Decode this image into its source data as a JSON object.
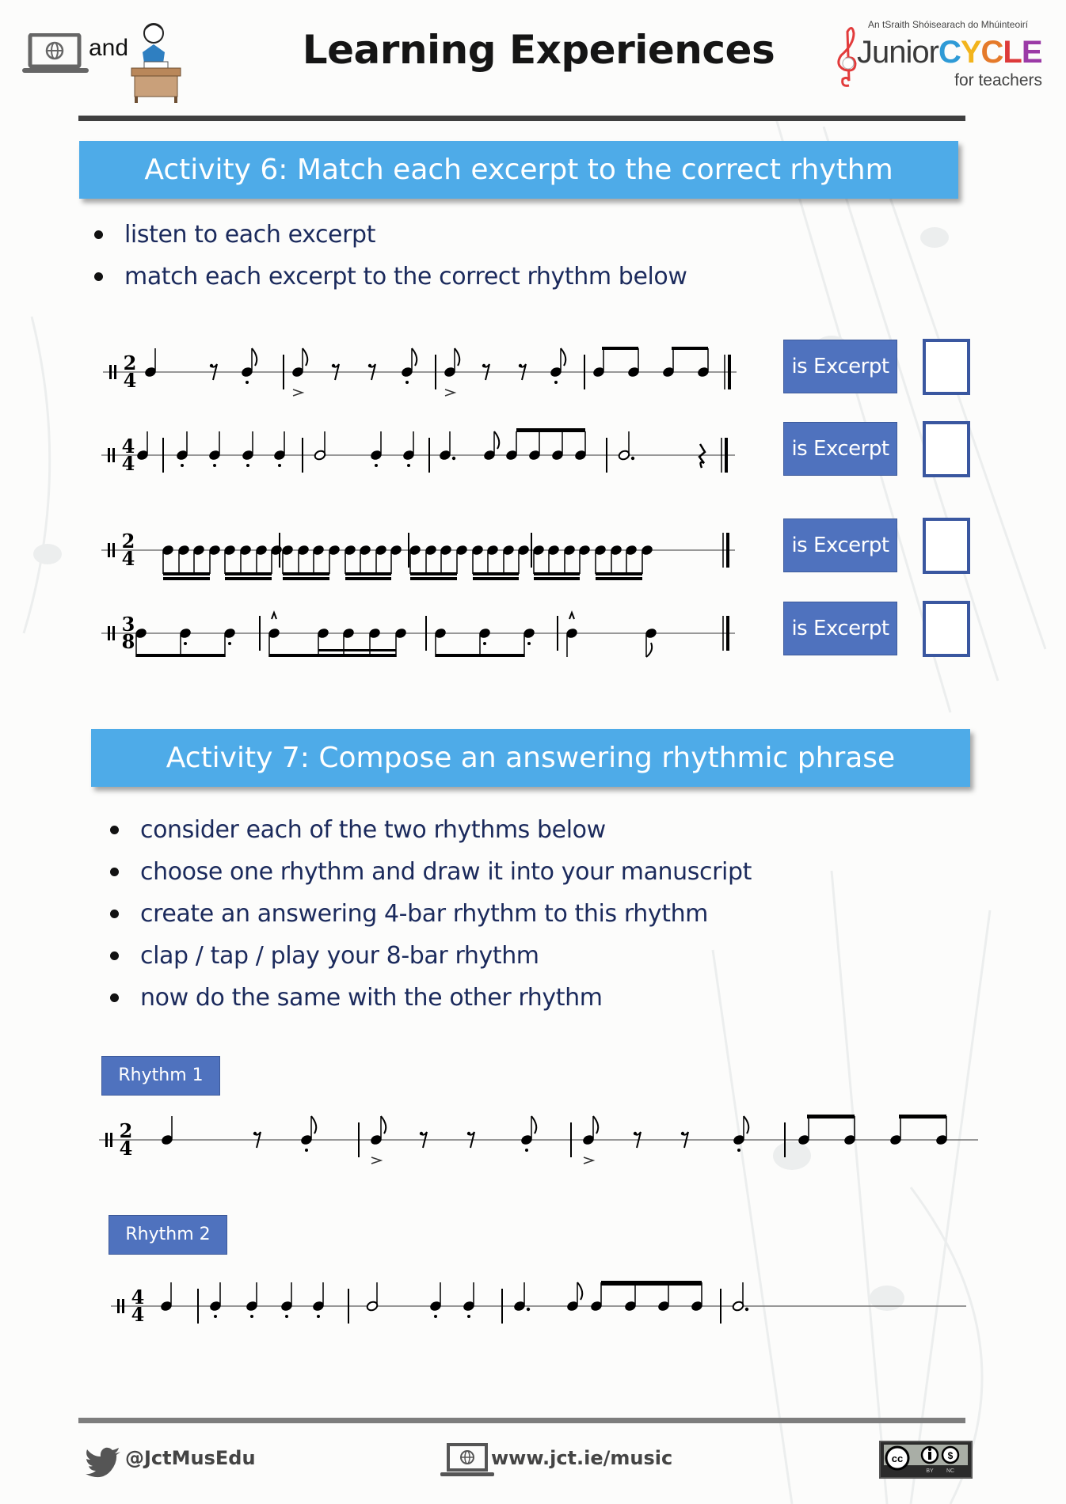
{
  "header": {
    "and_text": "and",
    "title": "Learning Experiences",
    "logo": {
      "tagline": "An tSraith Shóisearach do Mhúinteoirí",
      "brand_junior": "Junior",
      "brand_cycle_letters": [
        "C",
        "Y",
        "C",
        "L",
        "E"
      ],
      "brand_cycle_colors": [
        "#2e9ad6",
        "#f2b41c",
        "#e57a2a",
        "#dd3a3a",
        "#9b3aa6"
      ],
      "sub": "for teachers"
    },
    "icons": [
      "laptop-globe-icon",
      "student-at-desk-icon",
      "treble-clef-icon"
    ]
  },
  "activity6": {
    "title": "Activity 6: Match each excerpt to the correct rhythm",
    "bullets": [
      "listen to each excerpt",
      "match each excerpt to the correct rhythm below"
    ],
    "excerpts": [
      {
        "time_signature": "2/4",
        "button": "is Excerpt",
        "answer": ""
      },
      {
        "time_signature": "4/4",
        "button": "is Excerpt",
        "answer": ""
      },
      {
        "time_signature": "2/4",
        "button": "is Excerpt",
        "answer": ""
      },
      {
        "time_signature": "3/8",
        "button": "is Excerpt",
        "answer": ""
      }
    ]
  },
  "activity7": {
    "title": "Activity 7: Compose an answering rhythmic phrase",
    "bullets": [
      "consider each of the two rhythms below",
      "choose one rhythm and draw it into your manuscript",
      "create an answering 4-bar rhythm to this rhythm",
      "clap / tap / play your 8-bar rhythm",
      "now do the same with the other rhythm"
    ],
    "rhythm1": {
      "label": "Rhythm 1",
      "time_signature": "2/4"
    },
    "rhythm2": {
      "label": "Rhythm 2",
      "time_signature": "4/4"
    }
  },
  "footer": {
    "twitter": "@JctMusEdu",
    "website": "www.jct.ie/music",
    "license": {
      "cc": "cc",
      "by": "BY",
      "nc": "NC"
    }
  },
  "colors": {
    "banner": "#4eabe8",
    "button": "#4f72be",
    "bullet_text": "#1b2a5c",
    "checkbox_border": "#3a57a0"
  }
}
